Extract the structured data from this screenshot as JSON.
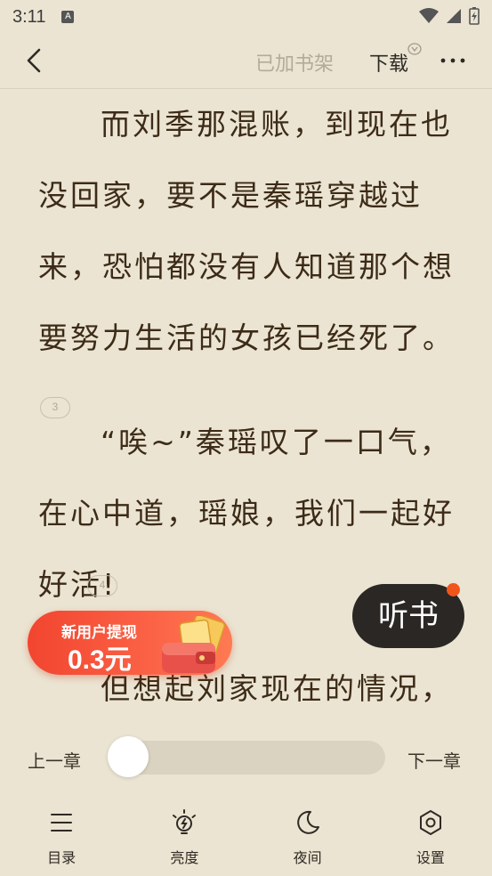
{
  "status_bar": {
    "time": "3:11",
    "notification": "A"
  },
  "top_bar": {
    "added_to_shelf": "已加书架",
    "download": "下载"
  },
  "content": {
    "paragraphs": [
      "而刘季那混账，到现在也没回家，要不是秦瑶穿越过来，恐怕都没有人知道那个想要努力生活的女孩已经死了。",
      "“唉~”秦瑶叹了一口气，在心中道，瑶娘，我们一起好好活!",
      "但想起刘家现在的情况，"
    ],
    "comment_counts": [
      "3",
      "4"
    ]
  },
  "promo": {
    "line1": "新用户提现",
    "line2": "0.3元"
  },
  "listen_button": {
    "label": "听书"
  },
  "chapter_nav": {
    "prev": "上一章",
    "next": "下一章",
    "progress": 0
  },
  "bottom_nav": [
    {
      "label": "目录",
      "icon": "list-icon"
    },
    {
      "label": "亮度",
      "icon": "brightness-icon"
    },
    {
      "label": "夜间",
      "icon": "moon-icon"
    },
    {
      "label": "设置",
      "icon": "settings-icon"
    }
  ]
}
